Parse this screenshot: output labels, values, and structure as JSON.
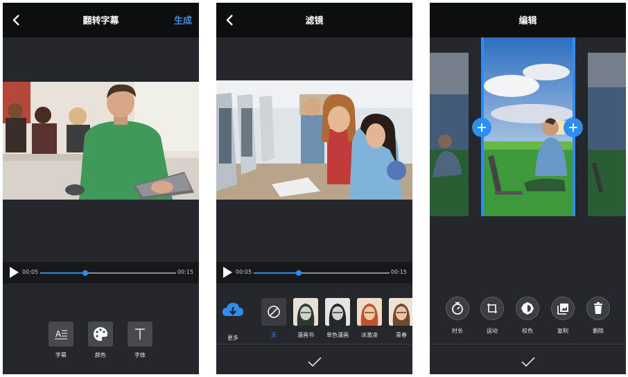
{
  "screens": [
    {
      "title": "翻转字幕",
      "action": "生成",
      "player": {
        "current": "00:05",
        "total": "00:15",
        "progress": 0.33
      },
      "tools": [
        {
          "label": "字幕",
          "icon": "subtitle-icon"
        },
        {
          "label": "颜色",
          "icon": "palette-icon"
        },
        {
          "label": "字体",
          "icon": "font-icon"
        }
      ]
    },
    {
      "title": "滤镜",
      "player": {
        "current": "00:05",
        "total": "00:15",
        "progress": 0.33
      },
      "more_label": "更多",
      "filters": [
        {
          "label": "无",
          "selected": true,
          "icon": "no-filter-icon"
        },
        {
          "label": "漫画书"
        },
        {
          "label": "单色漫画"
        },
        {
          "label": "冰激凌"
        },
        {
          "label": "青春"
        }
      ]
    },
    {
      "title": "编辑",
      "tools": [
        {
          "label": "时长",
          "icon": "timer-icon"
        },
        {
          "label": "运动",
          "icon": "crop-rotate-icon"
        },
        {
          "label": "校色",
          "icon": "brightness-icon"
        },
        {
          "label": "复制",
          "icon": "copy-icon"
        },
        {
          "label": "删除",
          "icon": "trash-icon"
        }
      ]
    }
  ],
  "colors": {
    "accent": "#2e8df0",
    "background": "#24272b",
    "topbar": "#0d0e10"
  }
}
